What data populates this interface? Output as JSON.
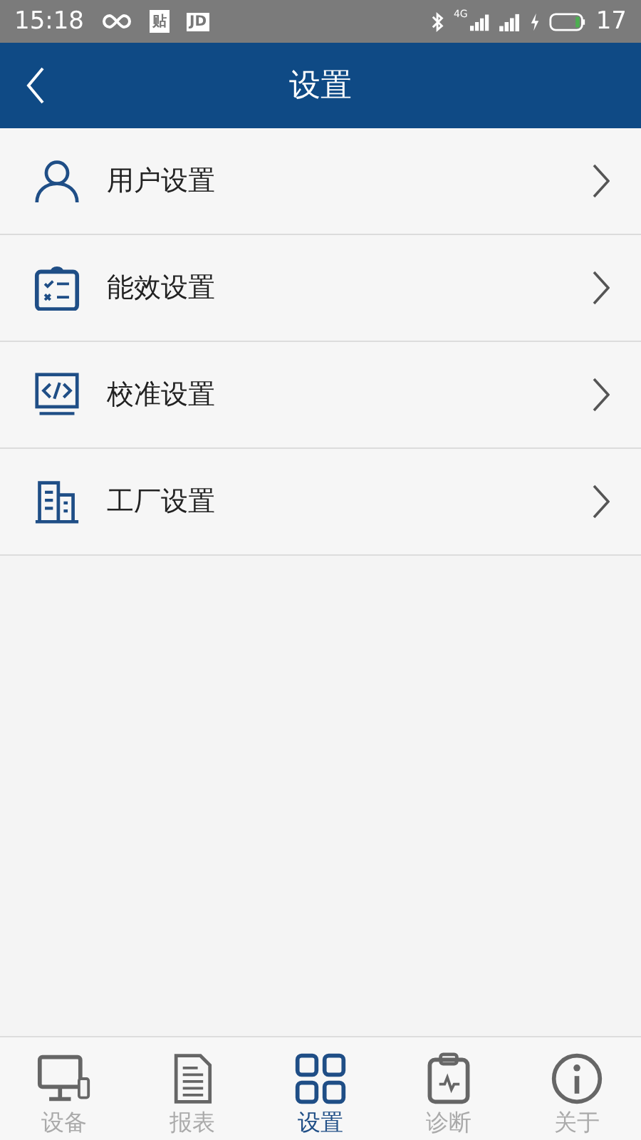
{
  "status_bar": {
    "time": "15:18",
    "badges": [
      "贴",
      "JD"
    ],
    "network": "4G",
    "battery": "17"
  },
  "header": {
    "title": "设置"
  },
  "items": [
    {
      "kind": "user",
      "label": "用户设置"
    },
    {
      "kind": "clipboard",
      "label": "能效设置"
    },
    {
      "kind": "code",
      "label": "校准设置"
    },
    {
      "kind": "building",
      "label": "工厂设置"
    }
  ],
  "tabs": [
    {
      "kind": "device",
      "label": "设备",
      "selected": false
    },
    {
      "kind": "report",
      "label": "报表",
      "selected": false
    },
    {
      "kind": "grid",
      "label": "设置",
      "selected": true
    },
    {
      "kind": "diagnose",
      "label": "诊断",
      "selected": false
    },
    {
      "kind": "about",
      "label": "关于",
      "selected": false
    }
  ]
}
